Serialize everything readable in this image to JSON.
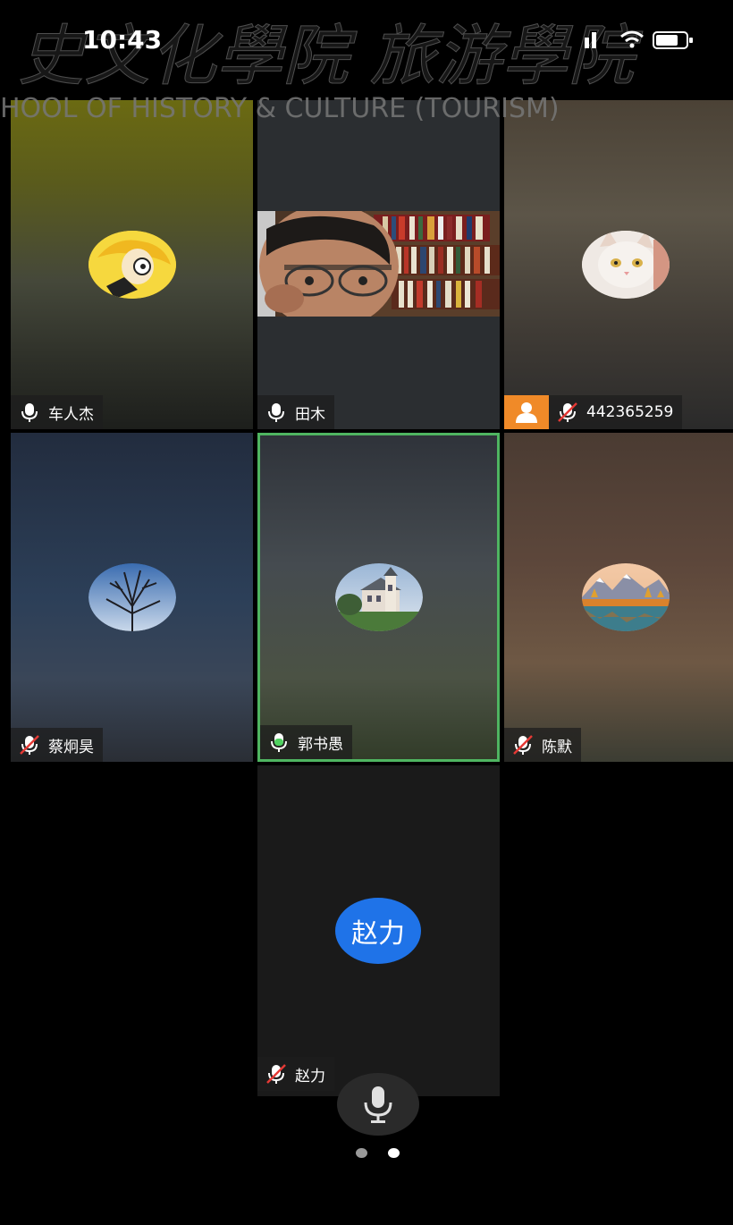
{
  "status_bar": {
    "time": "10:43"
  },
  "watermark": {
    "chinese": "史文化學院 旅游學院",
    "english": "HOOL OF HISTORY & CULTURE (TOURISM)"
  },
  "participants": [
    {
      "name": "车人杰",
      "mic": "on"
    },
    {
      "name": "田木",
      "mic": "on"
    },
    {
      "name": "442365259",
      "mic": "muted"
    },
    {
      "name": "蔡炯昊",
      "mic": "muted"
    },
    {
      "name": "郭书愚",
      "mic": "speaking",
      "active": true
    },
    {
      "name": "陈默",
      "mic": "muted"
    },
    {
      "name": "赵力",
      "mic": "muted",
      "avatar_text": "赵力"
    }
  ],
  "controls": {
    "mic_button": "microphone-icon",
    "page_indicator": {
      "pages": 2,
      "current": 2
    }
  },
  "colors": {
    "active_border": "#4fb561",
    "avatar_blue": "#1f73e8",
    "host_badge": "#f08a28"
  }
}
